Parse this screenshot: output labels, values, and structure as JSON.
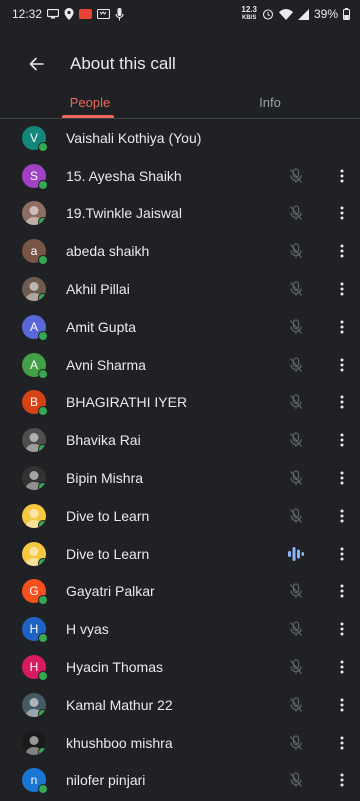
{
  "status_bar": {
    "time": "12:32",
    "speed_top": "12.3",
    "speed_bottom": "KB/S",
    "battery": "39%"
  },
  "header": {
    "title": "About this call"
  },
  "tabs": [
    {
      "label": "People",
      "active": true
    },
    {
      "label": "Info",
      "active": false
    }
  ],
  "participants": [
    {
      "name": "Vaishali Kothiya (You)",
      "initial": "V",
      "color": "#12877a",
      "mic": "none"
    },
    {
      "name": "15. Ayesha Shaikh",
      "initial": "S",
      "color": "#a142c4",
      "mic": "muted"
    },
    {
      "name": "19.Twinkle Jaiswal",
      "initial": "",
      "color": "#8d6e63",
      "mic": "muted",
      "photo": true
    },
    {
      "name": "abeda shaikh",
      "initial": "a",
      "color": "#795548",
      "mic": "muted"
    },
    {
      "name": "Akhil Pillai",
      "initial": "",
      "color": "#6d5c4f",
      "mic": "muted",
      "photo": true
    },
    {
      "name": "Amit Gupta",
      "initial": "A",
      "color": "#5a67d8",
      "mic": "muted"
    },
    {
      "name": "Avni Sharma",
      "initial": "A",
      "color": "#43a047",
      "mic": "muted"
    },
    {
      "name": "BHAGIRATHI IYER",
      "initial": "B",
      "color": "#d84315",
      "mic": "muted"
    },
    {
      "name": "Bhavika Rai",
      "initial": "",
      "color": "#4e4e4e",
      "mic": "muted",
      "photo": true
    },
    {
      "name": "Bipin Mishra",
      "initial": "",
      "color": "#333333",
      "mic": "muted",
      "photo": true
    },
    {
      "name": "Dive to Learn",
      "initial": "",
      "color": "#f5c842",
      "mic": "muted",
      "photo": true
    },
    {
      "name": "Dive to Learn",
      "initial": "",
      "color": "#f5c842",
      "mic": "speaking",
      "photo": true
    },
    {
      "name": "Gayatri Palkar",
      "initial": "G",
      "color": "#f4511e",
      "mic": "muted"
    },
    {
      "name": "H vyas",
      "initial": "H",
      "color": "#1e63c4",
      "mic": "muted"
    },
    {
      "name": "Hyacin Thomas",
      "initial": "H",
      "color": "#d81b60",
      "mic": "muted"
    },
    {
      "name": "Kamal Mathur 22",
      "initial": "",
      "color": "#455a64",
      "mic": "muted",
      "photo": true
    },
    {
      "name": "khushboo mishra",
      "initial": "",
      "color": "#1a1a1a",
      "mic": "muted",
      "photo": true
    },
    {
      "name": "nilofer pinjari",
      "initial": "n",
      "color": "#1976d2",
      "mic": "muted"
    }
  ],
  "colors": {
    "accent": "#ee675c",
    "online": "#34a853",
    "speaking": "#8ab4f8",
    "background": "#202124"
  }
}
